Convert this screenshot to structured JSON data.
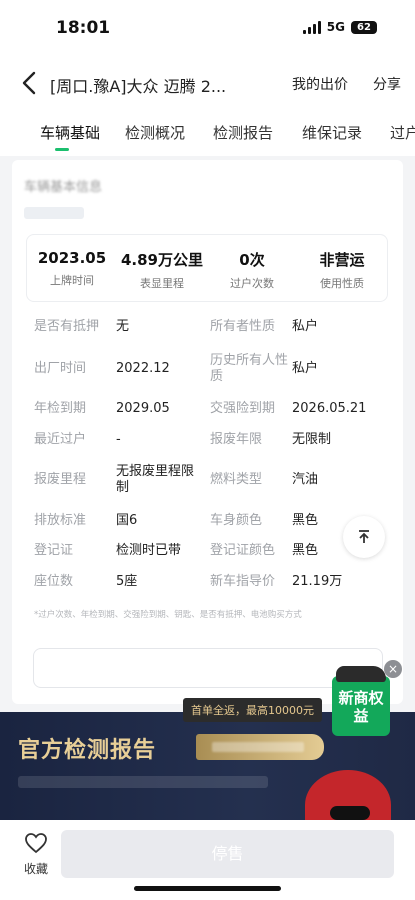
{
  "status": {
    "time": "18:01",
    "network": "5G",
    "battery": "62"
  },
  "nav": {
    "title": "[周口.豫A]大众 迈腾 2...",
    "my_bid": "我的出价",
    "share": "分享"
  },
  "tabs": [
    "车辆基础",
    "检测概况",
    "检测报告",
    "维保记录",
    "过户"
  ],
  "section": {
    "title": "车辆基本信息"
  },
  "summary": [
    {
      "value": "2023.05",
      "label": "上牌时间"
    },
    {
      "value": "4.89万公里",
      "label": "表显里程"
    },
    {
      "value": "0次",
      "label": "过户次数"
    },
    {
      "value": "非营运",
      "label": "使用性质"
    }
  ],
  "details": [
    {
      "l1": "是否有抵押",
      "v1": "无",
      "l2": "所有者性质",
      "v2": "私户"
    },
    {
      "l1": "出厂时间",
      "v1": "2022.12",
      "l2": "历史所有人性质",
      "v2": "私户"
    },
    {
      "l1": "年检到期",
      "v1": "2029.05",
      "l2": "交强险到期",
      "v2": "2026.05.21"
    },
    {
      "l1": "最近过户",
      "v1": "-",
      "l2": "报废年限",
      "v2": "无限制"
    },
    {
      "l1": "报废里程",
      "v1": "无报废里程限制",
      "l2": "燃料类型",
      "v2": "汽油"
    },
    {
      "l1": "排放标准",
      "v1": "国6",
      "l2": "车身颜色",
      "v2": "黑色"
    },
    {
      "l1": "登记证",
      "v1": "检测时已带",
      "l2": "登记证颜色",
      "v2": "黑色"
    },
    {
      "l1": "座位数",
      "v1": "5座",
      "l2": "新车指导价",
      "v2": "21.19万"
    }
  ],
  "footnote": "*过户次数、年检到期、交强险到期、钥匙、是否有抵押、电池购买方式",
  "promo": {
    "badge": "新商权益",
    "close": "×"
  },
  "banner": {
    "tag": "首单全返，最高10000元",
    "title": "官方检测报告"
  },
  "bottom": {
    "fav_label": "收藏",
    "stop_label": "停售"
  },
  "colors": {
    "accent": "#1bbf6e",
    "banner_bg": "#1a2440",
    "banner_gold": "#e8cf97"
  }
}
